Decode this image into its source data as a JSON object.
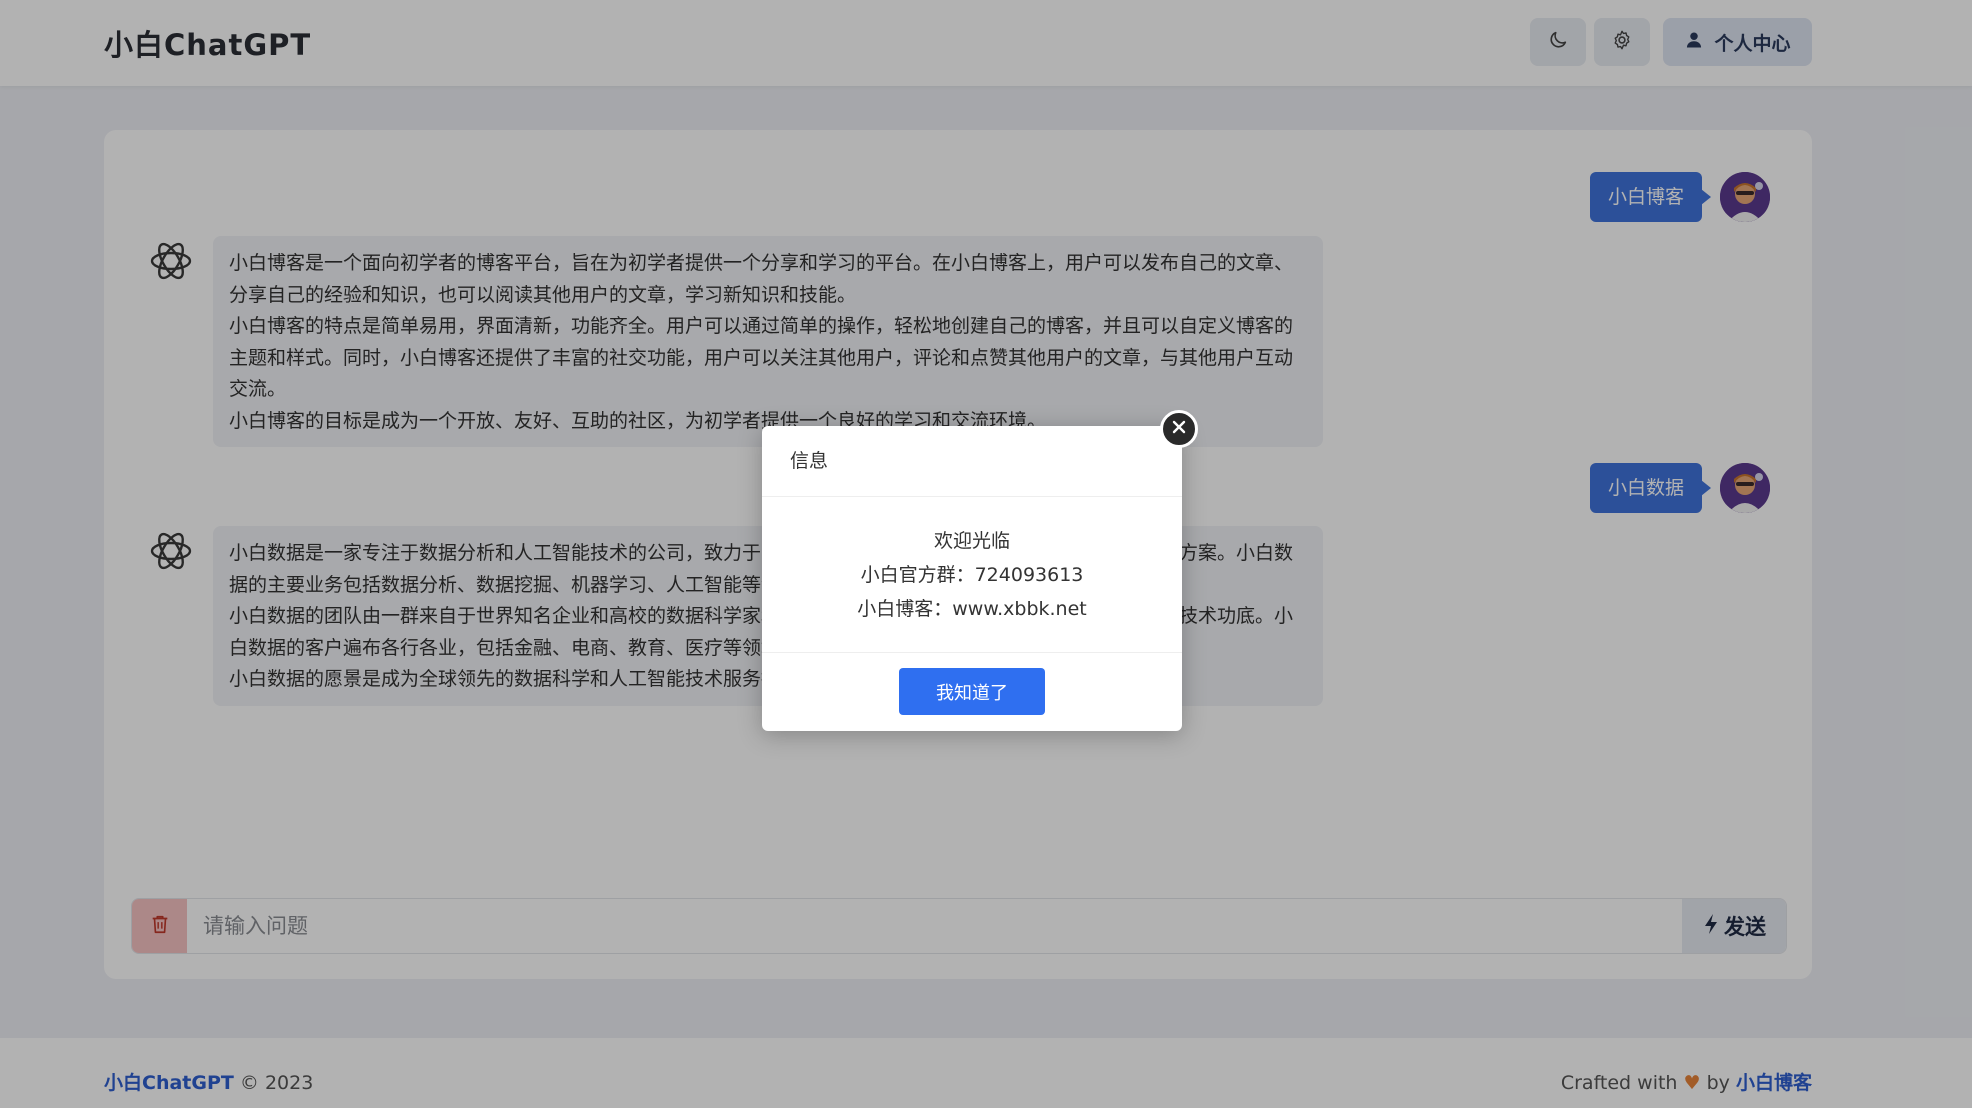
{
  "header": {
    "brand": "小白ChatGPT",
    "profile_label": "个人中心",
    "icons": {
      "theme": "moon-icon",
      "settings": "gear-icon",
      "profile": "user-icon"
    }
  },
  "conversation": [
    {
      "role": "user",
      "text": "小白博客"
    },
    {
      "role": "assistant",
      "paragraphs": [
        "小白博客是一个面向初学者的博客平台，旨在为初学者提供一个分享和学习的平台。在小白博客上，用户可以发布自己的文章、分享自己的经验和知识，也可以阅读其他用户的文章，学习新知识和技能。",
        "小白博客的特点是简单易用，界面清新，功能齐全。用户可以通过简单的操作，轻松地创建自己的博客，并且可以自定义博客的主题和样式。同时，小白博客还提供了丰富的社交功能，用户可以关注其他用户，评论和点赞其他用户的文章，与其他用户互动交流。",
        "小白博客的目标是成为一个开放、友好、互助的社区，为初学者提供一个良好的学习和交流环境。"
      ]
    },
    {
      "role": "user",
      "text": "小白数据"
    },
    {
      "role": "assistant",
      "paragraphs": [
        "小白数据是一家专注于数据分析和人工智能技术的公司，致力于为客户提供高效、准确的数据分析和人工智能解决方案。小白数据的主要业务包括数据分析、数据挖掘、机器学习、人工智能等领域的技术咨询和解决方案。",
        "小白数据的团队由一群来自于世界知名企业和高校的数据科学家和工程师组成，他们拥有丰富的行业经验和深厚的技术功底。小白数据的客户遍布各行各业，包括金融、电商、教育、医疗等领域。",
        "小白数据的愿景是成为全球领先的数据科学和人工智能技术服务提供商。"
      ]
    }
  ],
  "input": {
    "placeholder": "请输入问题",
    "send_label": "发送"
  },
  "footer": {
    "brand": "小白ChatGPT",
    "copyright": "© 2023",
    "crafted_prefix": "Crafted with",
    "heart": "♥",
    "by": "by",
    "author": "小白博客"
  },
  "modal": {
    "title": "信息",
    "lines": [
      "欢迎光临",
      "小白官方群：724093613",
      "小白博客：www.xbbk.net"
    ],
    "ok_label": "我知道了"
  }
}
